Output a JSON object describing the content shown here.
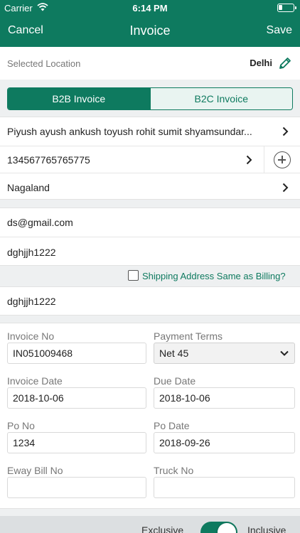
{
  "status_bar": {
    "carrier": "Carrier",
    "time": "6:14 PM",
    "battery_level": 0.25
  },
  "nav": {
    "cancel": "Cancel",
    "title": "Invoice",
    "save": "Save"
  },
  "location": {
    "label": "Selected Location",
    "value": "Delhi",
    "icon": "pencil-icon"
  },
  "invoice_type": {
    "options": [
      "B2B Invoice",
      "B2C Invoice"
    ],
    "selected": "B2B Invoice"
  },
  "customer": {
    "name": "Piyush ayush ankush toyush rohit sumit shyamsundar...",
    "gstin": "134567765765775",
    "state": "Nagaland"
  },
  "contact": {
    "email": "ds@gmail.com",
    "billing_address": "dghjjh1222"
  },
  "shipping": {
    "same_as_billing_label": "Shipping Address Same as Billing?",
    "same_as_billing": false,
    "address": "dghjjh1222"
  },
  "form": {
    "invoice_no": {
      "label": "Invoice No",
      "value": "IN051009468"
    },
    "payment_terms": {
      "label": "Payment Terms",
      "value": "Net 45"
    },
    "invoice_date": {
      "label": "Invoice Date",
      "value": "2018-10-06"
    },
    "due_date": {
      "label": "Due Date",
      "value": "2018-10-06"
    },
    "po_no": {
      "label": "Po No",
      "value": "1234"
    },
    "po_date": {
      "label": "Po Date",
      "value": "2018-09-26"
    },
    "eway_bill_no": {
      "label": "Eway Bill No",
      "value": ""
    },
    "truck_no": {
      "label": "Truck No",
      "value": ""
    }
  },
  "tax_mode": {
    "left_label": "Exclusive",
    "right_label": "Inclusive",
    "inclusive": true
  },
  "colors": {
    "brand": "#0e7a5f",
    "background": "#eef0f1"
  }
}
